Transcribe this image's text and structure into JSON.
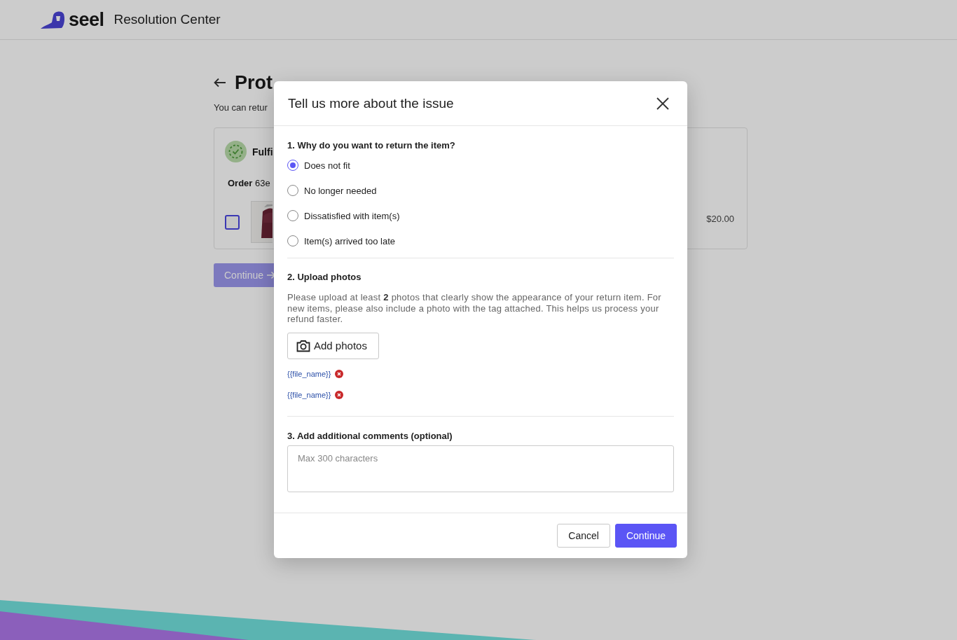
{
  "header": {
    "brand": "seel",
    "title": "Resolution Center"
  },
  "page": {
    "title": "Prot",
    "subtitle": "You can retur",
    "card": {
      "status": "Fulfi",
      "order": "**Order** 63e",
      "item": {
        "checked": false,
        "price": "$20.00"
      }
    },
    "continue_button": {
      "label": "Continue",
      "disabled": true
    }
  },
  "dialog": {
    "title": "Tell us more about the issue",
    "reason": {
      "heading": "1. Why do you want to return the item?",
      "options": [
        {
          "label": "Does not fit",
          "selected": true
        },
        {
          "label": "No longer needed",
          "selected": false
        },
        {
          "label": "Dissatisfied with item(s)",
          "selected": false
        },
        {
          "label": "Item(s) arrived too late",
          "selected": false
        }
      ]
    },
    "upload": {
      "heading": "2. Upload photos",
      "description": "Please upload at least **2** photos that clearly show the appearance of your return item. For new items, please also include a photo with the tag attached. This helps us process your refund faster.",
      "button": "Add photos",
      "files": [
        "{{file_name}}",
        "{{file_name}}"
      ]
    },
    "comments": {
      "heading": "3. Add additional comments (optional)",
      "placeholder": "Max 300 characters"
    },
    "buttons": {
      "cancel": "Cancel",
      "continue": "Continue"
    }
  }
}
